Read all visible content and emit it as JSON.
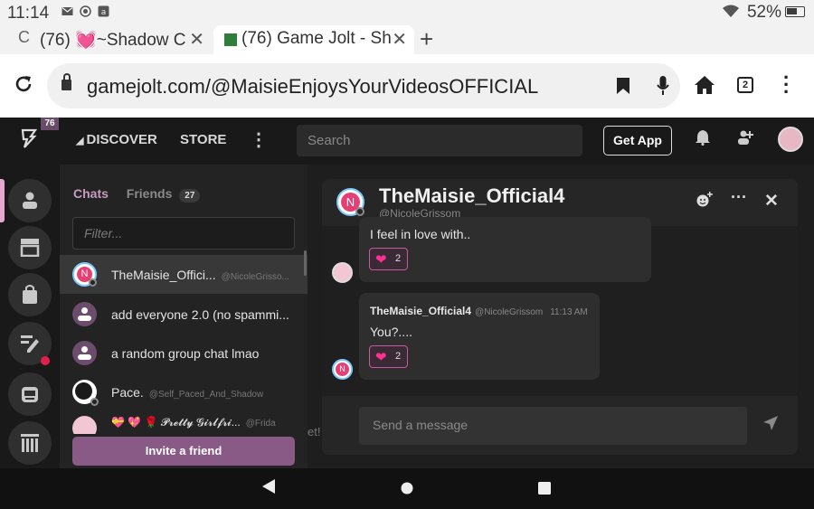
{
  "statusbar": {
    "time": "11:14",
    "battery": "52%"
  },
  "browser_tabs": [
    {
      "label": "(76) 💓~Shadow C",
      "close": "✕",
      "active": false
    },
    {
      "label": "(76) Game Jolt - Sh",
      "close": "✕",
      "active": true
    }
  ],
  "new_tab": "+",
  "url": "gamejolt.com/@MaisieEnjoysYourVideosOFFICIAL",
  "tab_count": "2",
  "header": {
    "notif_count": "76",
    "discover": "DISCOVER",
    "store": "STORE",
    "search_placeholder": "Search",
    "get_app": "Get App"
  },
  "chat_panel": {
    "tab_chats": "Chats",
    "tab_friends": "Friends",
    "friends_count": "27",
    "filter_placeholder": "Filter...",
    "items": [
      {
        "name": "TheMaisie_Offici...",
        "handle": "@NicoleGrisso..."
      },
      {
        "name": "add everyone 2.0 (no spammi...",
        "handle": ""
      },
      {
        "name": "a random group chat lmao",
        "handle": ""
      },
      {
        "name": "Pace.",
        "handle": "@Self_Paced_And_Shadow"
      },
      {
        "name": "💝 💖 🌹 𝓟𝓻𝓮𝓽𝓽𝔂 𝓖𝓲𝓻𝓵𝓯𝓻𝓲...",
        "handle": "@Frida"
      }
    ],
    "invite": "Invite a friend"
  },
  "background_text": "et!",
  "chat_window": {
    "title": "TheMaisie_Official4",
    "subtitle": "@NicoleGrissom",
    "messages": [
      {
        "text": "I feel in love with..",
        "reaction": "2"
      },
      {
        "author": "TheMaisie_Official4",
        "handle": "@NicoleGrissom",
        "time": "11:13 AM",
        "text": "You?....",
        "reaction": "2"
      }
    ],
    "composer_placeholder": "Send a message"
  },
  "colors": {
    "accent": "#c79ac3",
    "invite_button": "#8a5a86",
    "reaction_heart": "#ff2f95",
    "alert_dot": "#e0204b"
  }
}
